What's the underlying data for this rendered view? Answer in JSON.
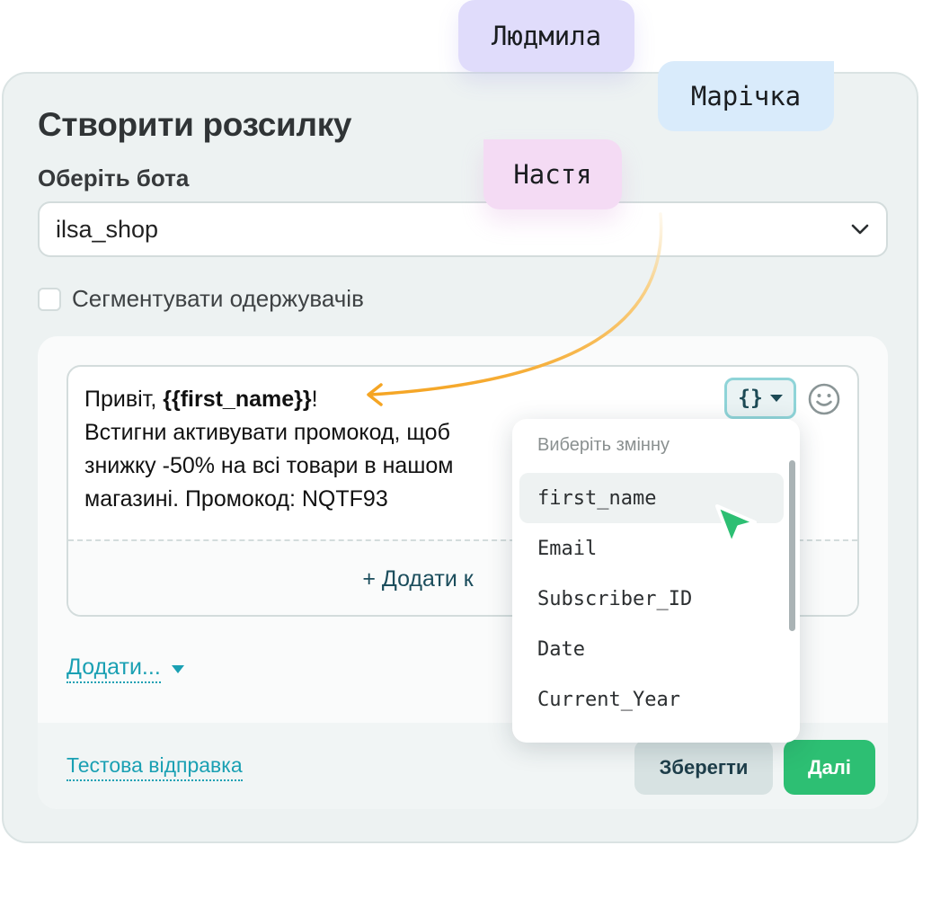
{
  "card": {
    "title": "Створити розсилку",
    "bot_label": "Оберіть бота",
    "bot_select_value": "ilsa_shop",
    "segment_label": "Сегментувати одержувачів"
  },
  "editor": {
    "greeting": "Привіт, ",
    "variable": "{{first_name}}",
    "greeting_end": "!",
    "line2": "Встигни активувати промокод, щоб",
    "line3": "знижку -50% на всі товари в нашом",
    "line4": "магазині. Промокод: NQTF93",
    "var_button_label": "{}",
    "add_button_label": "+ Додати к",
    "add_dropdown_label": "Додати..."
  },
  "footer": {
    "test_send": "Тестова відправка",
    "save": "Зберегти",
    "next": "Далі"
  },
  "variable_dropdown": {
    "header": "Виберіть змінну",
    "items": [
      "first_name",
      "Email",
      "Subscriber_ID",
      "Date",
      "Current_Year"
    ],
    "active": "first_name"
  },
  "bubbles": [
    "Людмила",
    "Марічка",
    "Настя"
  ],
  "colors": {
    "accent": "#1aa0b3",
    "primary_green": "#2dbf73",
    "arrow": "#f5a524"
  }
}
